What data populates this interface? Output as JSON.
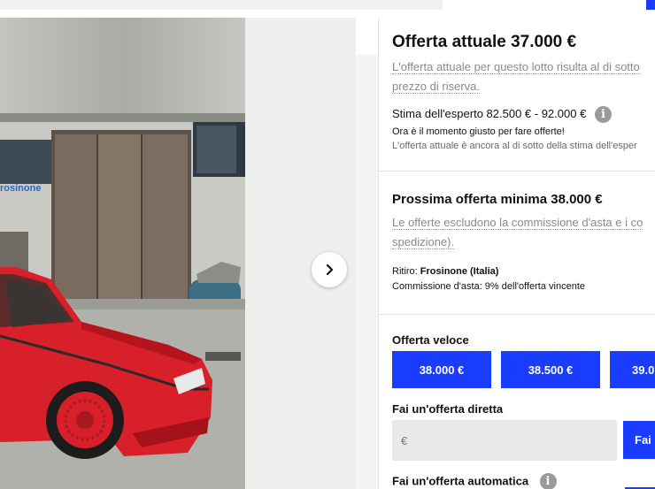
{
  "current_bid": {
    "title": "Offerta attuale 37.000 €",
    "reserve_note_line1": "L'offerta attuale per questo lotto risulta al di sotto",
    "reserve_note_line2": "prezzo di riserva.",
    "estimate": "Stima dell'esperto 82.500 € - 92.000 €",
    "hint1": "Ora è il momento giusto per fare offerte!",
    "hint2": "L'offerta attuale è ancora al di sotto della stima dell'esper"
  },
  "next_bid": {
    "title": "Prossima offerta minima 38.000 €",
    "fee_note_line1": "Le offerte escludono la commissione d'asta e i co",
    "fee_note_line2": "spedizione).",
    "pickup_label": "Ritiro:",
    "pickup_value": "Frosinone (Italia)",
    "commission": "Commissione d'asta: 9% dell'offerta vincente"
  },
  "quick_bid": {
    "title": "Offerta veloce",
    "options": [
      "38.000 €",
      "38.500 €",
      "39.0"
    ]
  },
  "direct_bid": {
    "title": "Fai un'offerta diretta",
    "placeholder": "€",
    "button": "Fai"
  },
  "auto_bid": {
    "title": "Fai un'offerta automatica"
  },
  "colors": {
    "accent": "#1a3cff",
    "car_red": "#d8202a"
  },
  "icons": {
    "next": "chevron-right-icon",
    "info": "info-icon"
  }
}
